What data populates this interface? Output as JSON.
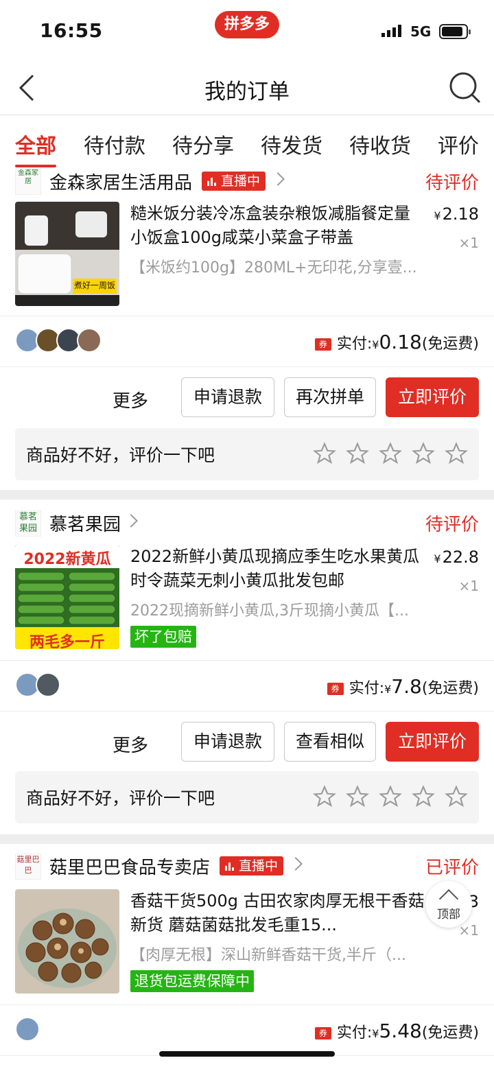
{
  "status_bar": {
    "time": "16:55",
    "app_logo_text": "拼多多",
    "network": "5G"
  },
  "nav": {
    "title": "我的订单",
    "back_icon": "chevron-left-icon",
    "search_icon": "search-icon"
  },
  "tabs": [
    {
      "label": "全部",
      "active": true
    },
    {
      "label": "待付款"
    },
    {
      "label": "待分享"
    },
    {
      "label": "待发货"
    },
    {
      "label": "待收货"
    },
    {
      "label": "评价"
    }
  ],
  "orders": [
    {
      "shop_name": "金森家居生活用品",
      "shop_logo_text": "金森家居",
      "live_badge": "直播中",
      "status": "待评价",
      "product_name": "糙米饭分装冷冻盒装杂粮饭减脂餐定量小饭盒100g咸菜小菜盒子带盖",
      "price": "2.18",
      "quantity": "×1",
      "spec": "【米饭约100g】280ML+无印花,分享壹...",
      "image_caption": "煮好一周饭",
      "paid_label": "实付:",
      "paid_amount": "0.18",
      "shipping": "(免运费)",
      "coupon": "券",
      "more_label": "更多",
      "buttons": [
        "申请退款",
        "再次拼单",
        "立即评价"
      ],
      "rate_prompt": "商品好不好，评价一下吧"
    },
    {
      "shop_name": "慕茗果园",
      "shop_logo_text": "慕茗果园",
      "status": "待评价",
      "product_name": "2022新鲜小黄瓜现摘应季生吃水果黄瓜时令蔬菜无刺小黄瓜批发包邮",
      "price": "22.8",
      "quantity": "×1",
      "spec": "2022现摘新鲜小黄瓜,3斤现摘小黄瓜【...",
      "image_top_text": "2022新黄瓜",
      "image_bottom_text": "两毛多一斤",
      "guarantee_badge": "坏了包赔",
      "paid_label": "实付:",
      "paid_amount": "7.8",
      "shipping": "(免运费)",
      "coupon": "券",
      "more_label": "更多",
      "buttons": [
        "申请退款",
        "查看相似",
        "立即评价"
      ],
      "rate_prompt": "商品好不好，评价一下吧"
    },
    {
      "shop_name": "菇里巴巴食品专卖店",
      "shop_logo_text": "菇里巴巴",
      "live_badge": "直播中",
      "status": "已评价",
      "product_name": "香菇干货500g 古田农家肉厚无根干香菇新货 蘑菇菌菇批发毛重15...",
      "price": "3",
      "quantity": "×1",
      "spec": "【肉厚无根】深山新鲜香菇干货,半斤（...",
      "guarantee_badge": "退货包运费保障中",
      "paid_label": "实付:",
      "paid_amount": "5.48",
      "shipping": "(免运费)",
      "coupon": "券"
    }
  ],
  "to_top_label": "顶部",
  "currency_symbol": "¥",
  "colors": {
    "brand_red": "#e02e24",
    "green_badge": "#25b513",
    "gray_text": "#9c9c9c"
  }
}
